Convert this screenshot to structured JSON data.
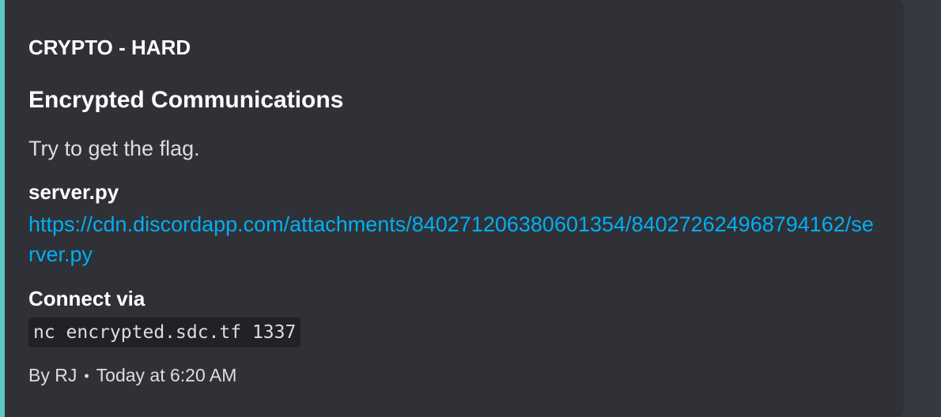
{
  "embed": {
    "accent_color": "#5fc7c4",
    "author": "CRYPTO - HARD",
    "title": "Encrypted Communications",
    "description": "Try to get the flag.",
    "fields": [
      {
        "name": "server.py",
        "link_text": "https://cdn.discordapp.com/attachments/840271206380601354/840272624968794162/server.py"
      },
      {
        "name": "Connect via",
        "code": "nc encrypted.sdc.tf 1337"
      }
    ],
    "footer": {
      "author": "By RJ",
      "separator": "•",
      "timestamp": "Today at 6:20 AM"
    }
  }
}
